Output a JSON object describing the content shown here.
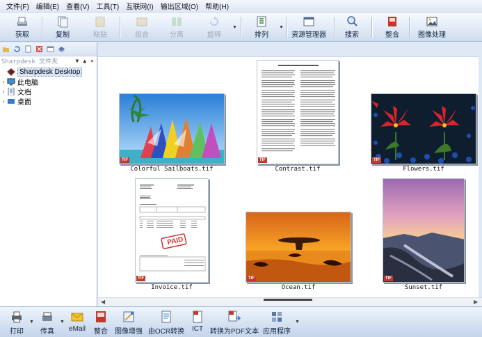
{
  "menu": [
    "文件(F)",
    "编辑(E)",
    "查看(V)",
    "工具(T)",
    "互联网(I)",
    "输出区域(O)",
    "帮助(H)"
  ],
  "toolbar": {
    "acquire": "获取",
    "copy": "复制",
    "paste": "粘贴",
    "combine": "组合",
    "split": "分离",
    "rotate": "旋转",
    "arrange": "排列",
    "resource_manager": "资源管理器",
    "search": "搜索",
    "organize": "整合",
    "image_processing": "图像处理"
  },
  "panel": {
    "title": "Sharpdesk 文件夹",
    "root": "Sharpdesk Desktop",
    "items": [
      "此电脑",
      "文档",
      "桌面"
    ]
  },
  "thumbnails": [
    {
      "name": "Colorful Sailboats.tif",
      "badge": "TIF"
    },
    {
      "name": "Contrast.tif",
      "badge": "TIF"
    },
    {
      "name": "Flowers.tif",
      "badge": "TIF"
    },
    {
      "name": "Invoice.tif",
      "badge": "TIF",
      "stamp": "PAID"
    },
    {
      "name": "Ocean.tif",
      "badge": "TIF"
    },
    {
      "name": "Sunset.tif",
      "badge": "TIF"
    }
  ],
  "bottombar": {
    "print": "打印",
    "fax": "传真",
    "email": "eMail",
    "organize": "整合",
    "image_enhance": "图像增强",
    "ocr": "由OCR转换",
    "ict": "ICT",
    "to_pdf": "转换为PDF文本",
    "apps": "应用程序"
  },
  "colors": {
    "accent": "#c0392b",
    "panel_bg": "#dfe8f5",
    "selection": "#d5e4f7"
  }
}
